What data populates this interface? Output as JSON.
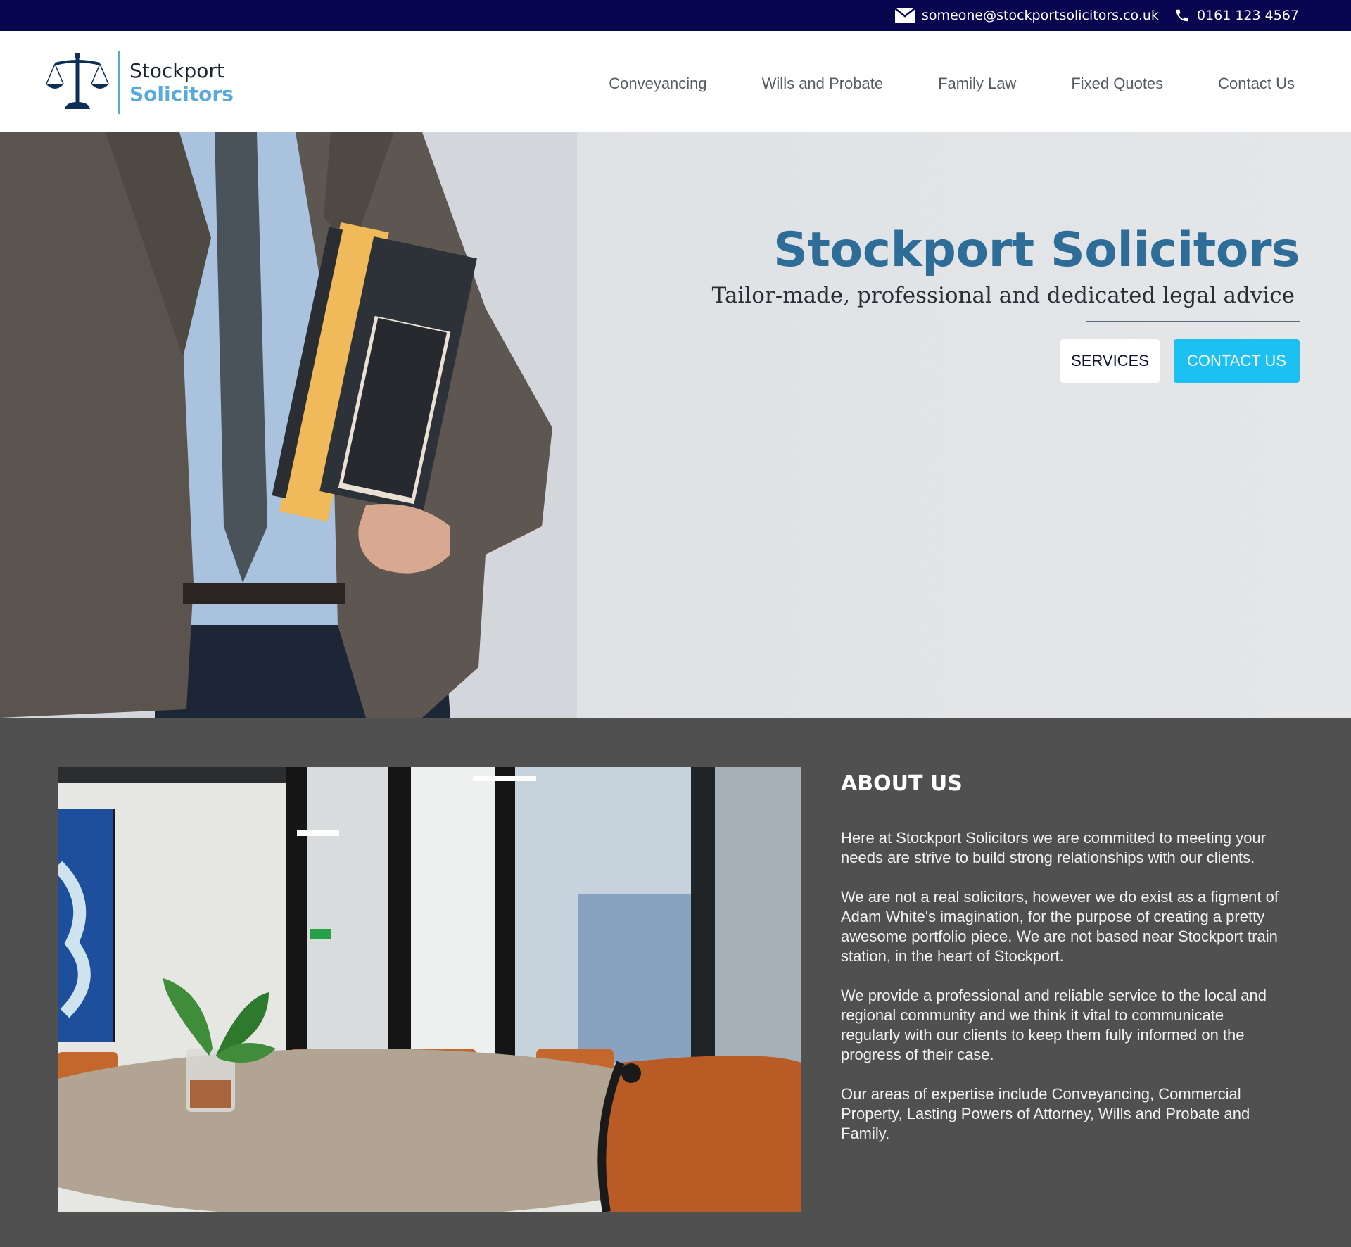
{
  "topbar": {
    "email": "someone@stockportsolicitors.co.uk",
    "phone": "0161 123 4567",
    "email_icon": "envelope-icon",
    "phone_icon": "phone-icon"
  },
  "logo": {
    "line1": "Stockport",
    "line2": "Solicitors",
    "icon": "scales-of-justice-icon"
  },
  "nav": {
    "items": [
      "Conveyancing",
      "Wills and Probate",
      "Family Law",
      "Fixed Quotes",
      "Contact Us"
    ]
  },
  "hero": {
    "title": "Stockport Solicitors",
    "subtitle": "Tailor-made, professional and dedicated legal advice",
    "services_label": "SERVICES",
    "contact_label": "CONTACT US"
  },
  "about": {
    "heading": "ABOUT US",
    "paragraphs": [
      "Here at Stockport Solicitors we are committed to meeting your needs are strive to build strong relationships with our clients.",
      "We are not a real solicitors, however we do exist as a figment of Adam White's imagination, for the purpose of creating a pretty awesome portfolio piece. We are not based near Stockport train station, in the heart of Stockport.",
      "We provide a professional and reliable service to the local and regional community and we think it vital to communicate regularly with our clients to keep them fully informed on the progress of their case.",
      "Our areas of expertise include Conveyancing, Commercial Property, Lasting Powers of Attorney, Wills and Probate and Family."
    ]
  },
  "colors": {
    "topbar": "#08064f",
    "brand_blue": "#2d6d98",
    "accent": "#1cc0f3",
    "about_bg": "#505050"
  }
}
